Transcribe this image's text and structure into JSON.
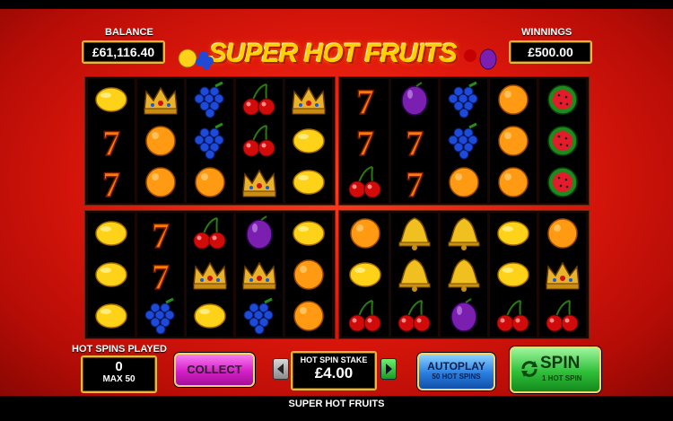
{
  "balance": {
    "label": "BALANCE",
    "value": "£61,116.40"
  },
  "winnings": {
    "label": "WINNINGS",
    "value": "£500.00"
  },
  "title": "SUPER HOT FRUITS",
  "hot_spins": {
    "label": "HOT SPINS PLAYED",
    "count": "0",
    "max": "MAX 50"
  },
  "collect_label": "COLLECT",
  "stake": {
    "label": "HOT SPIN STAKE",
    "value": "£4.00"
  },
  "autoplay": {
    "line1": "AUTOPLAY",
    "line2": "50 HOT SPINS"
  },
  "spin": {
    "line1": "SPIN",
    "line2": "1 HOT SPIN"
  },
  "footer": "SUPER HOT FRUITS",
  "colors": {
    "accent_gold": "#e6b93a",
    "background_red": "#e0180c",
    "collect_magenta": "#e23bd6",
    "autoplay_blue": "#2a7de0",
    "spin_green": "#2fbf3a"
  },
  "grids": [
    {
      "name": "top-left",
      "reels": [
        [
          "lemon",
          "seven",
          "seven"
        ],
        [
          "crown",
          "orange",
          "orange"
        ],
        [
          "grapes",
          "grapes",
          "orange"
        ],
        [
          "cherry",
          "cherry",
          "crown"
        ],
        [
          "crown",
          "lemon",
          "lemon"
        ]
      ]
    },
    {
      "name": "top-right",
      "reels": [
        [
          "seven",
          "seven",
          "cherry"
        ],
        [
          "plum",
          "seven",
          "seven"
        ],
        [
          "grapes",
          "grapes",
          "orange"
        ],
        [
          "orange",
          "orange",
          "orange"
        ],
        [
          "watermelon",
          "watermelon",
          "watermelon"
        ]
      ]
    },
    {
      "name": "bottom-left",
      "reels": [
        [
          "lemon",
          "lemon",
          "lemon"
        ],
        [
          "seven",
          "seven",
          "grapes"
        ],
        [
          "cherry",
          "crown",
          "lemon"
        ],
        [
          "plum",
          "crown",
          "grapes"
        ],
        [
          "lemon",
          "orange",
          "orange"
        ]
      ]
    },
    {
      "name": "bottom-right",
      "reels": [
        [
          "orange",
          "lemon",
          "cherry"
        ],
        [
          "bell",
          "bell",
          "cherry"
        ],
        [
          "bell",
          "bell",
          "plum"
        ],
        [
          "lemon",
          "lemon",
          "cherry"
        ],
        [
          "orange",
          "crown",
          "cherry"
        ]
      ]
    }
  ]
}
